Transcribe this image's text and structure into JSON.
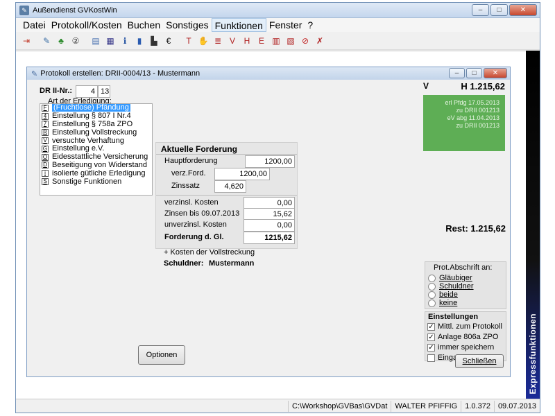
{
  "window": {
    "title": "Außendienst GVKostWin",
    "min_glyph": "–",
    "max_glyph": "□",
    "close_glyph": "✕"
  },
  "menu": [
    "Datei",
    "Protokoll/Kosten",
    "Buchen",
    "Sonstiges",
    "Funktionen",
    "Fenster",
    "?"
  ],
  "toolbar_icons": [
    {
      "name": "exit-door-icon",
      "glyph": "⇥",
      "color": "#c23a2a"
    },
    {
      "name": "edit-pen-icon",
      "glyph": "✎",
      "color": "#3a6ea5"
    },
    {
      "name": "tree-icon",
      "glyph": "♣",
      "color": "#2b8a2b"
    },
    {
      "name": "number-two-icon",
      "glyph": "②",
      "color": "#333333"
    },
    {
      "name": "document-icon",
      "glyph": "▤",
      "color": "#4a72b0"
    },
    {
      "name": "calendar-icon",
      "glyph": "▦",
      "color": "#3a3a8a"
    },
    {
      "name": "info-icon",
      "glyph": "ℹ",
      "color": "#1f4fa0"
    },
    {
      "name": "book-icon",
      "glyph": "▮",
      "color": "#2a5bb0"
    },
    {
      "name": "printer-icon",
      "glyph": "▙",
      "color": "#333333"
    },
    {
      "name": "euro-icon",
      "glyph": "€",
      "color": "#111111"
    },
    {
      "name": "form-t-icon",
      "glyph": "T",
      "color": "#b02020"
    },
    {
      "name": "handshake-icon",
      "glyph": "✋",
      "color": "#b07a20"
    },
    {
      "name": "form-list-icon",
      "glyph": "≣",
      "color": "#b02020"
    },
    {
      "name": "form-va-icon",
      "glyph": "V",
      "color": "#b02020"
    },
    {
      "name": "form-hb-icon",
      "glyph": "H",
      "color": "#b02020"
    },
    {
      "name": "form-ev-icon",
      "glyph": "E",
      "color": "#b02020"
    },
    {
      "name": "form-doc-icon",
      "glyph": "▥",
      "color": "#b02020"
    },
    {
      "name": "form-image-icon",
      "glyph": "▧",
      "color": "#b02020"
    },
    {
      "name": "no-entry-icon",
      "glyph": "⊘",
      "color": "#c02020"
    },
    {
      "name": "cancel-x-icon",
      "glyph": "✗",
      "color": "#b02020"
    }
  ],
  "child": {
    "title": "Protokoll erstellen: DRII-0004/13 - Mustermann"
  },
  "dr": {
    "label": "DR II-Nr.:",
    "number": "4",
    "year": "13"
  },
  "erledigung": {
    "label": "Art der Erledigung:",
    "items": [
      {
        "key": "F",
        "text": "(Fruchtlose) Pfändung",
        "selected": true
      },
      {
        "key": "4",
        "text": "Einstellung § 807 I Nr.4",
        "selected": false
      },
      {
        "key": "7",
        "text": "Einstellung § 758a ZPO",
        "selected": false
      },
      {
        "key": "R",
        "text": "Einstellung Vollstreckung",
        "selected": false
      },
      {
        "key": "V",
        "text": "versuchte Verhaftung",
        "selected": false
      },
      {
        "key": "G",
        "text": "Einstellung e.V.",
        "selected": false
      },
      {
        "key": "O",
        "text": "Eidesstattliche Versicherung",
        "selected": false
      },
      {
        "key": "D",
        "text": "Beseitigung von Widerstand",
        "selected": false
      },
      {
        "key": "i",
        "text": "isolierte gütliche Erledigung",
        "selected": false
      },
      {
        "key": "S",
        "text": "Sonstige Funktionen",
        "selected": false
      }
    ]
  },
  "forderung": {
    "title": "Aktuelle Forderung",
    "hauptforderung_label": "Hauptforderung",
    "hauptforderung_value": "1200,00",
    "verz_label": "verz.Ford.",
    "verz_value": "1200,00",
    "zinssatz_label": "Zinssatz",
    "zinssatz_value": "4,620",
    "verzinsl_label": "verzinsl. Kosten",
    "verzinsl_value": "0,00",
    "zinsen_label": "Zinsen bis 09.07.2013",
    "zinsen_value": "15,62",
    "unverzinsl_label": "unverzinsl. Kosten",
    "unverzinsl_value": "0,00",
    "total_label": "Forderung d. Gl.",
    "total_value": "1215,62",
    "kosten_note": "+ Kosten der Vollstreckung",
    "schuldner_label": "Schuldner:",
    "schuldner_value": "Mustermann"
  },
  "right": {
    "v_label": "V",
    "h_label": "H 1.215,62",
    "green_lines": [
      "erl Pfdg 17.05.2013",
      "zu DRII 001213",
      "eV abg 11.04.2013",
      "zu DRII 001213"
    ],
    "green_color": "#5eae55",
    "rest": "Rest: 1.215,62"
  },
  "abschrift": {
    "title": "Prot.Abschrift an:",
    "options": [
      "Gläubiger",
      "Schuldner",
      "beide",
      "keine"
    ]
  },
  "einstellungen": {
    "title": "Einstellungen",
    "options": [
      {
        "label": "Mittl. zum Protokoll",
        "checked": true
      },
      {
        "label": "Anlage 806a ZPO",
        "checked": true
      },
      {
        "label": "immer speichern",
        "checked": true
      },
      {
        "label": "Eingabe n. löschen",
        "checked": false
      }
    ]
  },
  "buttons": {
    "optionen": "Optionen",
    "schliessen": "Schließen"
  },
  "express_label": "Expressfunktionen",
  "statusbar": {
    "path": "C:\\Workshop\\GVBas\\GVDat",
    "user": "WALTER PFIFFIG",
    "version": "1.0.372",
    "date": "09.07.2013"
  }
}
